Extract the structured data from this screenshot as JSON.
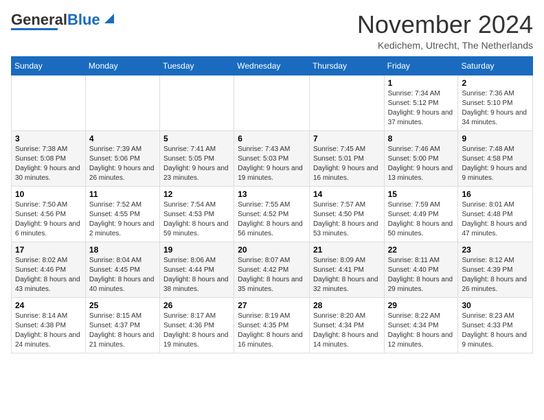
{
  "logo": {
    "part1": "General",
    "part2": "Blue"
  },
  "header": {
    "month": "November 2024",
    "location": "Kedichem, Utrecht, The Netherlands"
  },
  "weekdays": [
    "Sunday",
    "Monday",
    "Tuesday",
    "Wednesday",
    "Thursday",
    "Friday",
    "Saturday"
  ],
  "weeks": [
    [
      {
        "day": "",
        "info": ""
      },
      {
        "day": "",
        "info": ""
      },
      {
        "day": "",
        "info": ""
      },
      {
        "day": "",
        "info": ""
      },
      {
        "day": "",
        "info": ""
      },
      {
        "day": "1",
        "info": "Sunrise: 7:34 AM\nSunset: 5:12 PM\nDaylight: 9 hours and 37 minutes."
      },
      {
        "day": "2",
        "info": "Sunrise: 7:36 AM\nSunset: 5:10 PM\nDaylight: 9 hours and 34 minutes."
      }
    ],
    [
      {
        "day": "3",
        "info": "Sunrise: 7:38 AM\nSunset: 5:08 PM\nDaylight: 9 hours and 30 minutes."
      },
      {
        "day": "4",
        "info": "Sunrise: 7:39 AM\nSunset: 5:06 PM\nDaylight: 9 hours and 26 minutes."
      },
      {
        "day": "5",
        "info": "Sunrise: 7:41 AM\nSunset: 5:05 PM\nDaylight: 9 hours and 23 minutes."
      },
      {
        "day": "6",
        "info": "Sunrise: 7:43 AM\nSunset: 5:03 PM\nDaylight: 9 hours and 19 minutes."
      },
      {
        "day": "7",
        "info": "Sunrise: 7:45 AM\nSunset: 5:01 PM\nDaylight: 9 hours and 16 minutes."
      },
      {
        "day": "8",
        "info": "Sunrise: 7:46 AM\nSunset: 5:00 PM\nDaylight: 9 hours and 13 minutes."
      },
      {
        "day": "9",
        "info": "Sunrise: 7:48 AM\nSunset: 4:58 PM\nDaylight: 9 hours and 9 minutes."
      }
    ],
    [
      {
        "day": "10",
        "info": "Sunrise: 7:50 AM\nSunset: 4:56 PM\nDaylight: 9 hours and 6 minutes."
      },
      {
        "day": "11",
        "info": "Sunrise: 7:52 AM\nSunset: 4:55 PM\nDaylight: 9 hours and 2 minutes."
      },
      {
        "day": "12",
        "info": "Sunrise: 7:54 AM\nSunset: 4:53 PM\nDaylight: 8 hours and 59 minutes."
      },
      {
        "day": "13",
        "info": "Sunrise: 7:55 AM\nSunset: 4:52 PM\nDaylight: 8 hours and 56 minutes."
      },
      {
        "day": "14",
        "info": "Sunrise: 7:57 AM\nSunset: 4:50 PM\nDaylight: 8 hours and 53 minutes."
      },
      {
        "day": "15",
        "info": "Sunrise: 7:59 AM\nSunset: 4:49 PM\nDaylight: 8 hours and 50 minutes."
      },
      {
        "day": "16",
        "info": "Sunrise: 8:01 AM\nSunset: 4:48 PM\nDaylight: 8 hours and 47 minutes."
      }
    ],
    [
      {
        "day": "17",
        "info": "Sunrise: 8:02 AM\nSunset: 4:46 PM\nDaylight: 8 hours and 43 minutes."
      },
      {
        "day": "18",
        "info": "Sunrise: 8:04 AM\nSunset: 4:45 PM\nDaylight: 8 hours and 40 minutes."
      },
      {
        "day": "19",
        "info": "Sunrise: 8:06 AM\nSunset: 4:44 PM\nDaylight: 8 hours and 38 minutes."
      },
      {
        "day": "20",
        "info": "Sunrise: 8:07 AM\nSunset: 4:42 PM\nDaylight: 8 hours and 35 minutes."
      },
      {
        "day": "21",
        "info": "Sunrise: 8:09 AM\nSunset: 4:41 PM\nDaylight: 8 hours and 32 minutes."
      },
      {
        "day": "22",
        "info": "Sunrise: 8:11 AM\nSunset: 4:40 PM\nDaylight: 8 hours and 29 minutes."
      },
      {
        "day": "23",
        "info": "Sunrise: 8:12 AM\nSunset: 4:39 PM\nDaylight: 8 hours and 26 minutes."
      }
    ],
    [
      {
        "day": "24",
        "info": "Sunrise: 8:14 AM\nSunset: 4:38 PM\nDaylight: 8 hours and 24 minutes."
      },
      {
        "day": "25",
        "info": "Sunrise: 8:15 AM\nSunset: 4:37 PM\nDaylight: 8 hours and 21 minutes."
      },
      {
        "day": "26",
        "info": "Sunrise: 8:17 AM\nSunset: 4:36 PM\nDaylight: 8 hours and 19 minutes."
      },
      {
        "day": "27",
        "info": "Sunrise: 8:19 AM\nSunset: 4:35 PM\nDaylight: 8 hours and 16 minutes."
      },
      {
        "day": "28",
        "info": "Sunrise: 8:20 AM\nSunset: 4:34 PM\nDaylight: 8 hours and 14 minutes."
      },
      {
        "day": "29",
        "info": "Sunrise: 8:22 AM\nSunset: 4:34 PM\nDaylight: 8 hours and 12 minutes."
      },
      {
        "day": "30",
        "info": "Sunrise: 8:23 AM\nSunset: 4:33 PM\nDaylight: 8 hours and 9 minutes."
      }
    ]
  ]
}
